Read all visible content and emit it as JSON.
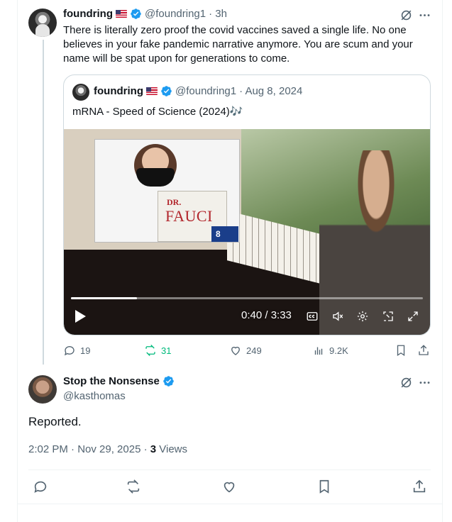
{
  "post": {
    "author": {
      "name": "foundring",
      "handle": "@foundring1",
      "time": "· 3h"
    },
    "text": "There is literally zero proof the covid vaccines saved a single life. No one believes in your fake pandemic narrative anymore. You are scum and your name will be spat upon for generations to come.",
    "quote": {
      "author": {
        "name": "foundring",
        "handle": "@foundring1",
        "date": "· Aug 8, 2024"
      },
      "text": "mRNA - Speed of Science (2024)🎶",
      "video": {
        "sign_prefix": "DR.",
        "sign_name": "FAUCI",
        "station_logo": "8",
        "time": "0:40 / 3:33",
        "progress": 0.188
      }
    },
    "stats": {
      "replies": "19",
      "reposts": "31",
      "likes": "249",
      "views": "9.2K"
    }
  },
  "reply": {
    "author": {
      "name": "Stop the Nonsense",
      "handle": "@kasthomas"
    },
    "text": "Reported.",
    "time": "2:02 PM · Nov 29, 2025 · ",
    "views_count": "3",
    "views_label": " Views"
  },
  "colors": {
    "accent": "#1d9bf0",
    "repost_active": "#00ba7c",
    "muted": "#536471",
    "border": "#cfd9de"
  }
}
